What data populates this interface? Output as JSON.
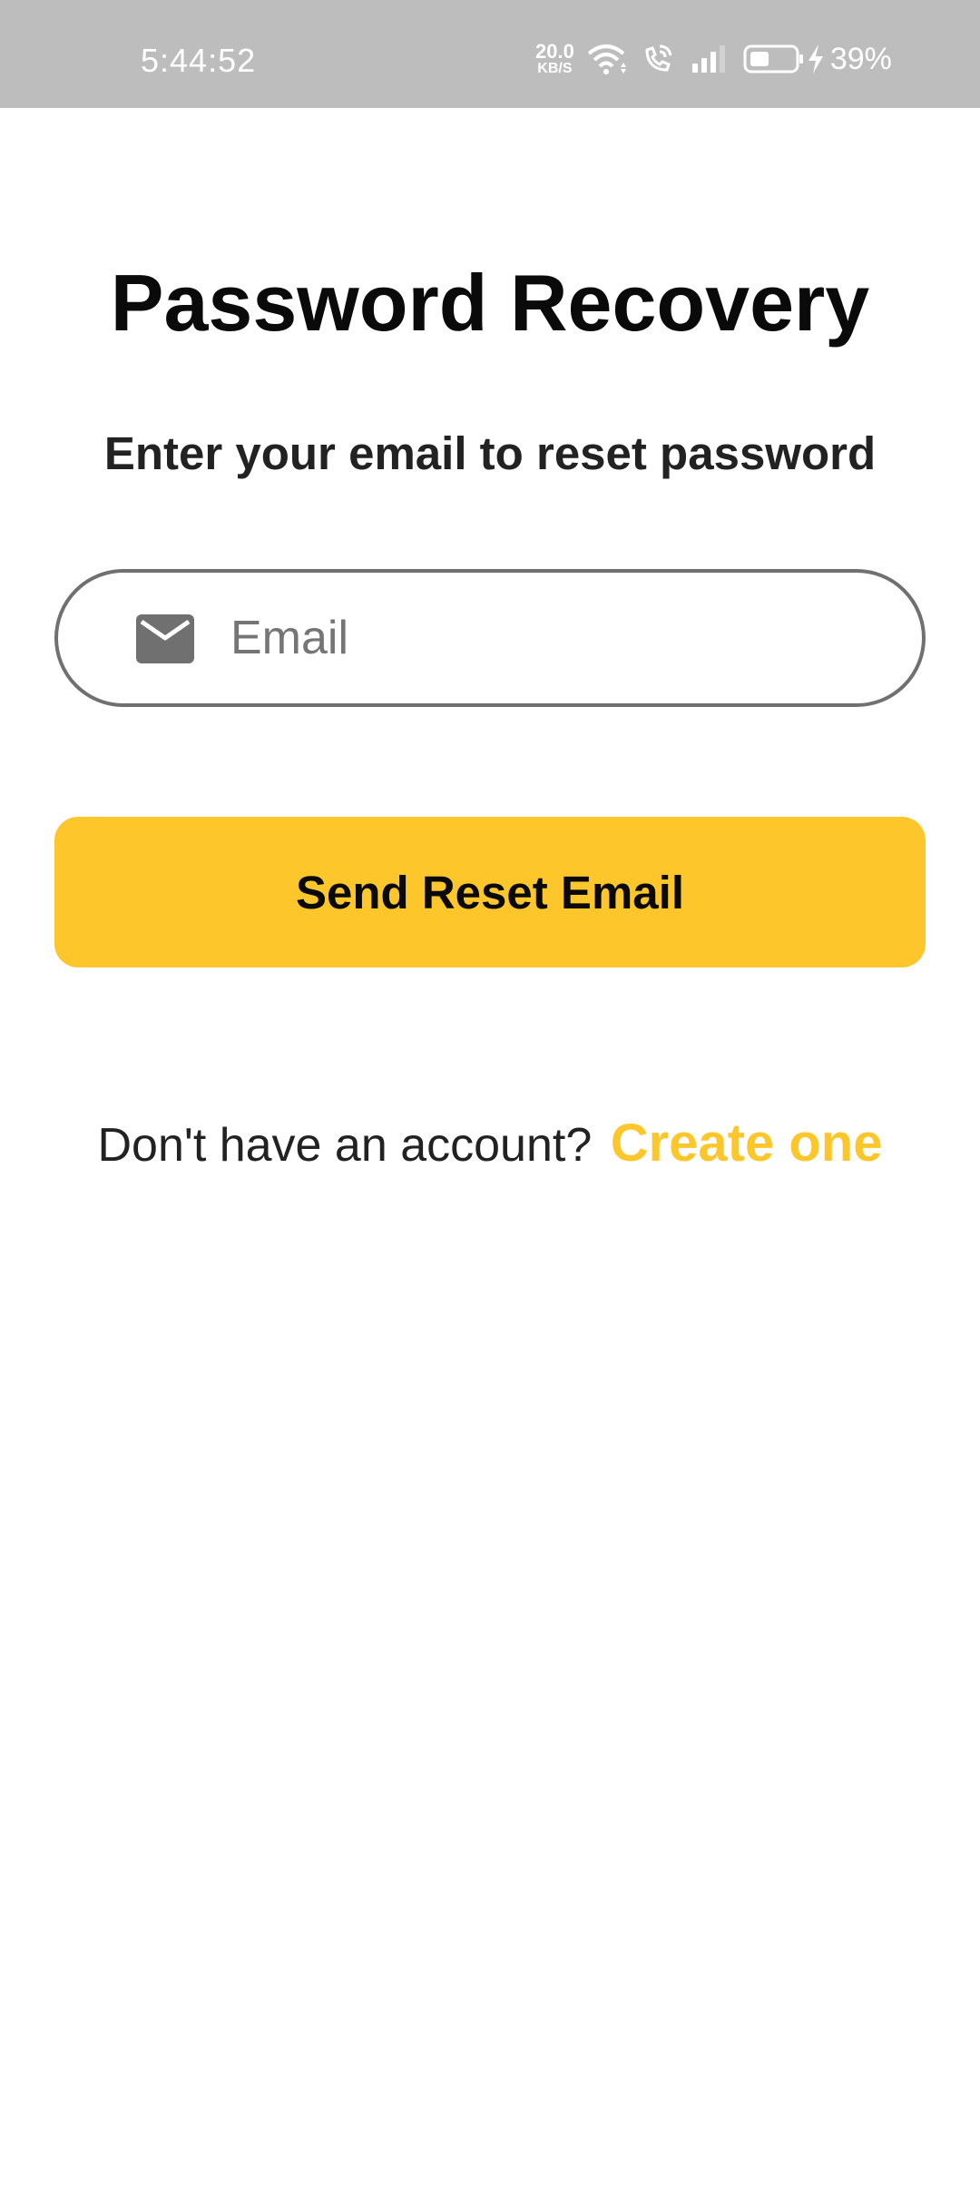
{
  "status_bar": {
    "time": "5:44:52",
    "net_speed_value": "20.0",
    "net_speed_unit": "KB/S",
    "battery_percent": "39%"
  },
  "page": {
    "title": "Password Recovery",
    "subtitle": "Enter your email to reset password"
  },
  "email_field": {
    "placeholder": "Email",
    "value": "",
    "icon": "mail-icon"
  },
  "send_button": {
    "label": "Send Reset Email"
  },
  "signup": {
    "prompt": "Don't have an account?",
    "link_label": "Create one"
  },
  "colors": {
    "accent": "#fdc72c",
    "status_bar": "#bdbdbd",
    "field_border": "#707070"
  }
}
